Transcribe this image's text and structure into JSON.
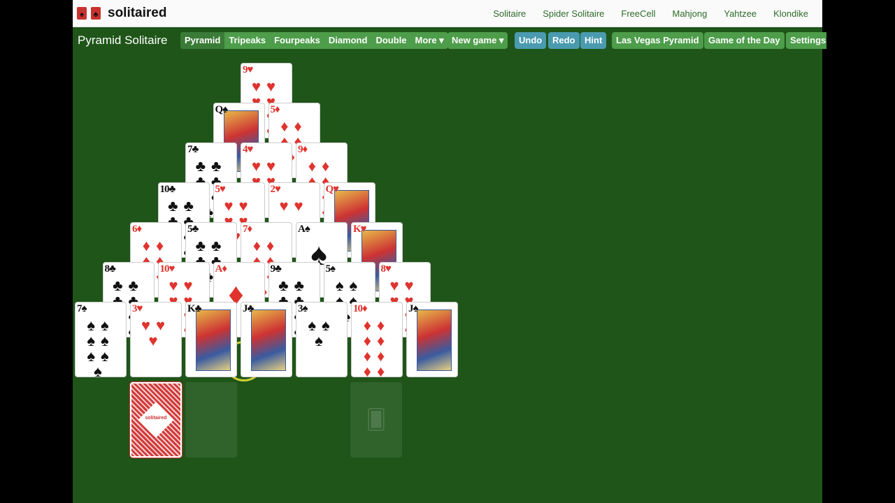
{
  "brand": {
    "name": "solitaired"
  },
  "top_nav": [
    "Solitaire",
    "Spider Solitaire",
    "FreeCell",
    "Mahjong",
    "Yahtzee",
    "Klondike"
  ],
  "game_title": "Pyramid Solitaire",
  "variants": {
    "items": [
      "Pyramid",
      "Tripeaks",
      "Fourpeaks",
      "Diamond",
      "Double",
      "More ▾"
    ],
    "active": "Pyramid"
  },
  "actions": {
    "new_game": "New game ▾",
    "undo": "Undo",
    "redo": "Redo",
    "hint": "Hint",
    "las_vegas": "Las Vegas Pyramid",
    "game_of_day": "Game of the Day",
    "settings": "Settings"
  },
  "pyramid": [
    [
      "9♥"
    ],
    [
      "Q♠",
      "5♦"
    ],
    [
      "7♣",
      "4♥",
      "9♦"
    ],
    [
      "10♣",
      "5♥",
      "2♥",
      "Q♥"
    ],
    [
      "6♦",
      "5♣",
      "7♦",
      "A♠",
      "K♥"
    ],
    [
      "8♣",
      "10♥",
      "A♦",
      "9♣",
      "5♠",
      "8♥"
    ],
    [
      "7♠",
      "3♥",
      "K♣",
      "J♣",
      "3♠",
      "10♦",
      "J♠"
    ]
  ],
  "stock": {
    "back_label": "solitaired",
    "state": "face-down"
  },
  "waste": {
    "state": "empty"
  },
  "foundation": {
    "state": "empty"
  },
  "colors": {
    "felt": "#1f5519",
    "button": "#4d9d4a",
    "button_blue": "#4a9bb0",
    "red_suit": "#e0332e"
  }
}
